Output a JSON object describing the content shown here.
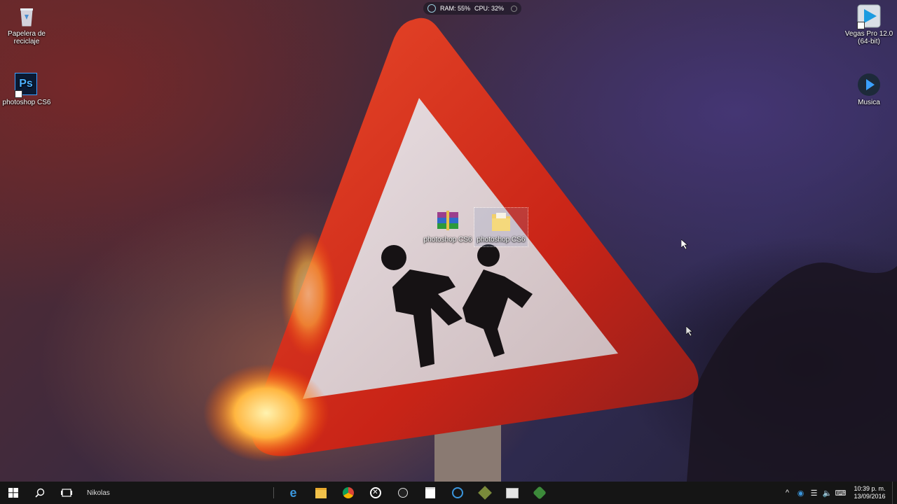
{
  "sysmon": {
    "ram": "RAM: 55%",
    "cpu": "CPU: 32%"
  },
  "desktop": {
    "icons_left": [
      {
        "label": "Papelera de reciclaje",
        "icon": "recycle-bin-icon"
      },
      {
        "label": "photoshop CS6",
        "icon": "photoshop-icon",
        "badge": "Ps"
      }
    ],
    "icons_right": [
      {
        "label": "Vegas Pro 12.0 (64-bit)",
        "icon": "vegas-pro-icon"
      },
      {
        "label": "Musica",
        "icon": "music-play-icon"
      }
    ],
    "icons_center": [
      {
        "label": "photoshop CS6",
        "icon": "winrar-archive-icon"
      },
      {
        "label": "photoshop CS6",
        "icon": "folder-icon"
      }
    ]
  },
  "taskbar": {
    "user": "Nikolas",
    "pinned": [
      "edge-icon",
      "file-explorer-icon",
      "chrome-icon",
      "xbox-icon",
      "clock-app-icon",
      "store-icon",
      "ccleaner-icon",
      "app-icon",
      "photo-icon",
      "app2-icon"
    ]
  },
  "tray": {
    "time": "10:39 p. m.",
    "date": "13/09/2016"
  },
  "colors": {
    "taskbar": "#151515",
    "sign_red": "#d6301f",
    "sign_white": "#e8dedd"
  }
}
